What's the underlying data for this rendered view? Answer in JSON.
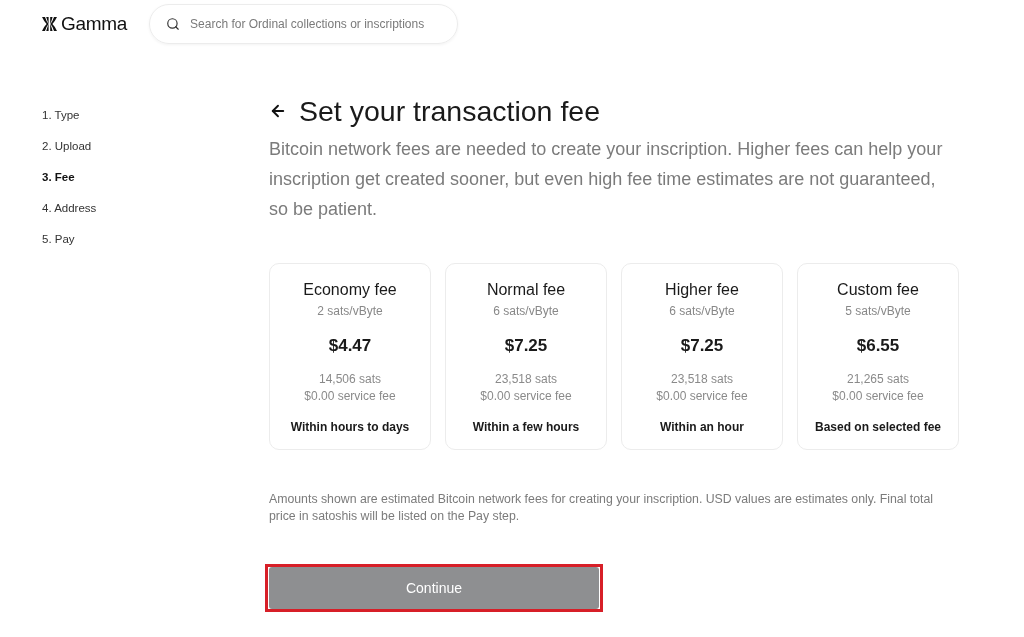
{
  "header": {
    "logo": {
      "text": "Gamma"
    },
    "search": {
      "placeholder": "Search for Ordinal collections or inscriptions"
    }
  },
  "steps": [
    {
      "label": "1. Type",
      "selected": false
    },
    {
      "label": "2. Upload",
      "selected": false
    },
    {
      "label": "3. Fee",
      "selected": true
    },
    {
      "label": "4. Address",
      "selected": false
    },
    {
      "label": "5. Pay",
      "selected": false
    }
  ],
  "page": {
    "title": "Set your transaction fee",
    "description": "Bitcoin network fees are needed to create your inscription. Higher fees can help your inscription get created sooner, but even high fee time estimates are not guaranteed, so be patient.",
    "fee_options": [
      {
        "name": "Economy fee",
        "rate": "2 sats/vByte",
        "price": "$4.47",
        "sats": "14,506 sats",
        "service_fee": "$0.00 service fee",
        "time_estimate": "Within hours to days",
        "selected": false
      },
      {
        "name": "Normal fee",
        "rate": "6 sats/vByte",
        "price": "$7.25",
        "sats": "23,518 sats",
        "service_fee": "$0.00 service fee",
        "time_estimate": "Within a few hours",
        "selected": false
      },
      {
        "name": "Higher fee",
        "rate": "6 sats/vByte",
        "price": "$7.25",
        "sats": "23,518 sats",
        "service_fee": "$0.00 service fee",
        "time_estimate": "Within an hour",
        "selected": false
      },
      {
        "name": "Custom fee",
        "rate": "5 sats/vByte",
        "price": "$6.55",
        "sats": "21,265 sats",
        "service_fee": "$0.00 service fee",
        "time_estimate": "Based on selected fee",
        "selected": false
      }
    ],
    "footnote": "Amounts shown are estimated Bitcoin network fees for creating your inscription. USD values are estimates only. Final total price in satoshis will be listed on the Pay step.",
    "continue_button": {
      "label": "Continue",
      "disabled": true,
      "highlighted": true
    }
  }
}
